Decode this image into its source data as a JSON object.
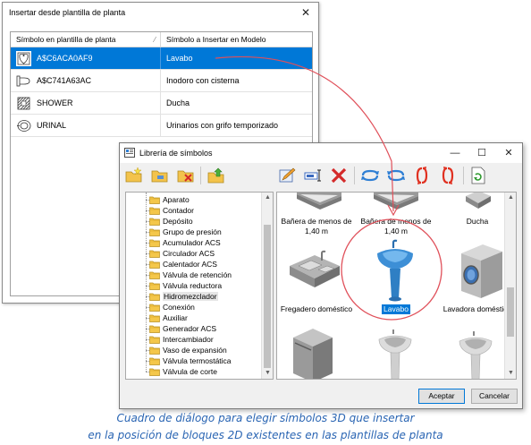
{
  "dialog1": {
    "title": "Insertar desde plantilla de planta",
    "columns": {
      "plan_symbol": "Símbolo en plantilla de planta",
      "model_symbol": "Símbolo a Insertar en Modelo"
    },
    "rows": [
      {
        "plan_symbol": "A$C6ACA0AF9",
        "model_symbol": "Lavabo",
        "icon": "washbasin-plan-icon",
        "selected": true
      },
      {
        "plan_symbol": "A$C741A63AC",
        "model_symbol": "Inodoro con cisterna",
        "icon": "toilet-plan-icon",
        "selected": false
      },
      {
        "plan_symbol": "SHOWER",
        "model_symbol": "Ducha",
        "icon": "shower-plan-icon",
        "selected": false
      },
      {
        "plan_symbol": "URINAL",
        "model_symbol": "Urinarios con grifo temporizado",
        "icon": "urinal-plan-icon",
        "selected": false
      }
    ]
  },
  "dialog2": {
    "title": "Librería de símbolos",
    "tree_items": [
      "Aparato",
      "Contador",
      "Depósito",
      "Grupo de presión",
      "Acumulador ACS",
      "Circulador ACS",
      "Calentador ACS",
      "Válvula de retención",
      "Válvula reductora",
      "Hidromezclador",
      "Conexión",
      "Auxiliar",
      "Generador ACS",
      "Intercambiador",
      "Vaso de expansión",
      "Válvula termostática",
      "Válvula de corte"
    ],
    "tree_highlighted": "Hidromezclador",
    "gallery": [
      {
        "label": "Bañera de menos de 1,40 m",
        "icon": "bathtub-icon"
      },
      {
        "label": "Bañera de menos de 1,40 m",
        "icon": "bathtub-icon"
      },
      {
        "label": "Ducha",
        "icon": "shower-icon"
      },
      {
        "label": "Fregadero doméstico",
        "icon": "kitchen-sink-icon"
      },
      {
        "label": "Lavabo",
        "icon": "washbasin-icon",
        "selected": true
      },
      {
        "label": "Lavadora doméstica",
        "icon": "washing-machine-icon"
      },
      {
        "label": "",
        "icon": "dishwasher-icon"
      },
      {
        "label": "",
        "icon": "pedestal-sink-icon"
      },
      {
        "label": "",
        "icon": "pedestal-sink-icon"
      }
    ],
    "accept_label": "Aceptar",
    "cancel_label": "Cancelar"
  },
  "caption": {
    "line1": "Cuadro de diálogo para elegir símbolos 3D que insertar",
    "line2": "en la posición de bloques 2D existentes en las plantillas de planta"
  },
  "colors": {
    "selection": "#0078d7",
    "annotation": "#e0505a",
    "caption": "#2a65b3"
  }
}
